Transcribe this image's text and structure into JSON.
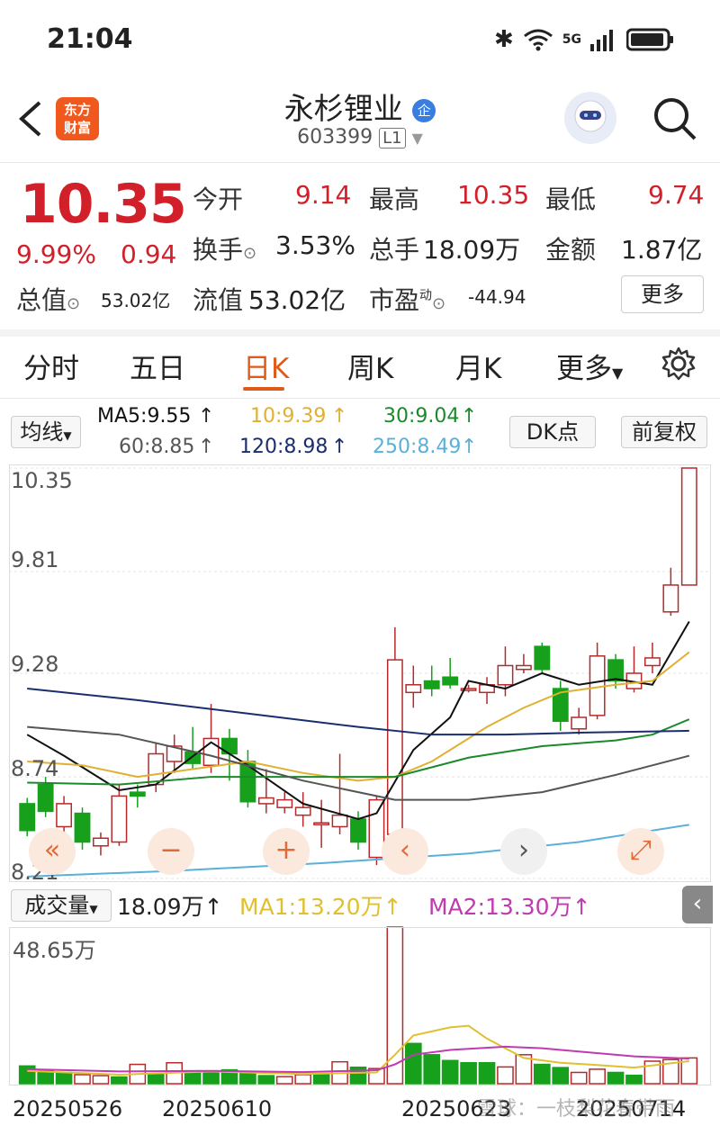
{
  "status": {
    "time": "21:04",
    "network": "5G"
  },
  "header": {
    "back_icon": "back-arrow-icon",
    "logo_line1": "东方",
    "logo_line2": "财富",
    "title": "永杉锂业",
    "badge": "企",
    "code": "603399",
    "code_suffix": "L1"
  },
  "quote": {
    "price": "10.35",
    "change_pct": "9.99%",
    "change": "0.94",
    "open_label": "今开",
    "open": "9.14",
    "high_label": "最高",
    "high": "10.35",
    "low_label": "最低",
    "low": "9.74",
    "turnover_label": "换手",
    "turnover": "3.53%",
    "volume_label": "总手",
    "volume": "18.09万",
    "amount_label": "金额",
    "amount": "1.87亿",
    "mcap_label": "总值",
    "mcap": "53.02亿",
    "float_label": "流值",
    "float": "53.02亿",
    "pe_label": "市盈",
    "pe_sup": "动",
    "pe": "-44.94",
    "more": "更多"
  },
  "tabs": [
    "分时",
    "五日",
    "日K",
    "周K",
    "月K",
    "更多"
  ],
  "active_tab": "日K",
  "ma": {
    "selector": "均线",
    "ma5": "MA5:9.55",
    "ma10": "10:9.39",
    "ma30": "30:9.04",
    "ma60": "60:8.85",
    "ma120": "120:8.98",
    "ma250": "250:8.49",
    "dk": "DK点",
    "adjust": "前复权"
  },
  "chart_data": {
    "type": "candlestick",
    "y_ticks": [
      "10.35",
      "9.81",
      "9.28",
      "8.74",
      "8.21"
    ],
    "ylim": [
      8.21,
      10.35
    ],
    "x_labels": [
      "20250526",
      "20250610",
      "20250623",
      "20250714"
    ],
    "candles": [
      {
        "o": 8.6,
        "c": 8.46,
        "h": 8.63,
        "l": 8.43
      },
      {
        "o": 8.7,
        "c": 8.56,
        "h": 8.74,
        "l": 8.53
      },
      {
        "o": 8.48,
        "c": 8.6,
        "h": 8.64,
        "l": 8.45
      },
      {
        "o": 8.55,
        "c": 8.4,
        "h": 8.58,
        "l": 8.36
      },
      {
        "o": 8.38,
        "c": 8.42,
        "h": 8.45,
        "l": 8.33
      },
      {
        "o": 8.4,
        "c": 8.64,
        "h": 8.7,
        "l": 8.38
      },
      {
        "o": 8.66,
        "c": 8.64,
        "h": 8.7,
        "l": 8.58
      },
      {
        "o": 8.7,
        "c": 8.86,
        "h": 8.92,
        "l": 8.66
      },
      {
        "o": 8.82,
        "c": 8.9,
        "h": 8.96,
        "l": 8.76
      },
      {
        "o": 8.87,
        "c": 8.81,
        "h": 9.0,
        "l": 8.78
      },
      {
        "o": 8.8,
        "c": 8.94,
        "h": 9.12,
        "l": 8.76
      },
      {
        "o": 8.94,
        "c": 8.86,
        "h": 8.99,
        "l": 8.72
      },
      {
        "o": 8.82,
        "c": 8.61,
        "h": 8.88,
        "l": 8.58
      },
      {
        "o": 8.6,
        "c": 8.63,
        "h": 8.78,
        "l": 8.55
      },
      {
        "o": 8.58,
        "c": 8.62,
        "h": 8.66,
        "l": 8.55
      },
      {
        "o": 8.54,
        "c": 8.58,
        "h": 8.66,
        "l": 8.48
      },
      {
        "o": 8.5,
        "c": 8.5,
        "h": 8.62,
        "l": 8.37
      },
      {
        "o": 8.48,
        "c": 8.54,
        "h": 8.86,
        "l": 8.44
      },
      {
        "o": 8.52,
        "c": 8.4,
        "h": 8.56,
        "l": 8.36
      },
      {
        "o": 8.32,
        "c": 8.62,
        "h": 8.64,
        "l": 8.28
      },
      {
        "o": 8.44,
        "c": 9.35,
        "h": 9.52,
        "l": 8.4
      },
      {
        "o": 9.18,
        "c": 9.22,
        "h": 9.32,
        "l": 9.1
      },
      {
        "o": 9.24,
        "c": 9.2,
        "h": 9.32,
        "l": 9.16
      },
      {
        "o": 9.26,
        "c": 9.22,
        "h": 9.36,
        "l": 9.2
      },
      {
        "o": 9.2,
        "c": 9.2,
        "h": 9.22,
        "l": 9.18
      },
      {
        "o": 9.18,
        "c": 9.22,
        "h": 9.26,
        "l": 9.12
      },
      {
        "o": 9.22,
        "c": 9.32,
        "h": 9.42,
        "l": 9.16
      },
      {
        "o": 9.3,
        "c": 9.32,
        "h": 9.38,
        "l": 9.28
      },
      {
        "o": 9.42,
        "c": 9.3,
        "h": 9.44,
        "l": 9.28
      },
      {
        "o": 9.2,
        "c": 9.03,
        "h": 9.24,
        "l": 8.98
      },
      {
        "o": 8.99,
        "c": 9.05,
        "h": 9.1,
        "l": 8.96
      },
      {
        "o": 9.06,
        "c": 9.37,
        "h": 9.44,
        "l": 9.04
      },
      {
        "o": 9.35,
        "c": 9.24,
        "h": 9.38,
        "l": 9.2
      },
      {
        "o": 9.2,
        "c": 9.28,
        "h": 9.42,
        "l": 9.18
      },
      {
        "o": 9.32,
        "c": 9.36,
        "h": 9.44,
        "l": 9.28
      },
      {
        "o": 9.6,
        "c": 9.74,
        "h": 9.83,
        "l": 9.58
      },
      {
        "o": 9.74,
        "c": 10.35,
        "h": 10.35,
        "l": 9.74
      }
    ],
    "ma_series": [
      {
        "name": "MA5",
        "color": "#111111",
        "points": [
          [
            0,
            8.96
          ],
          [
            2,
            8.85
          ],
          [
            5,
            8.67
          ],
          [
            7,
            8.7
          ],
          [
            10,
            8.92
          ],
          [
            12,
            8.8
          ],
          [
            15,
            8.6
          ],
          [
            18,
            8.52
          ],
          [
            19,
            8.55
          ],
          [
            21,
            8.88
          ],
          [
            23,
            9.05
          ],
          [
            24,
            9.24
          ],
          [
            26,
            9.2
          ],
          [
            28,
            9.28
          ],
          [
            30,
            9.22
          ],
          [
            32,
            9.25
          ],
          [
            34,
            9.22
          ],
          [
            36,
            9.55
          ]
        ]
      },
      {
        "name": "MA10",
        "color": "#e0b030",
        "points": [
          [
            0,
            8.82
          ],
          [
            3,
            8.8
          ],
          [
            6,
            8.74
          ],
          [
            9,
            8.78
          ],
          [
            12,
            8.82
          ],
          [
            15,
            8.76
          ],
          [
            18,
            8.72
          ],
          [
            20,
            8.74
          ],
          [
            22,
            8.82
          ],
          [
            25,
            9.0
          ],
          [
            27,
            9.1
          ],
          [
            29,
            9.18
          ],
          [
            32,
            9.22
          ],
          [
            34,
            9.24
          ],
          [
            36,
            9.39
          ]
        ]
      },
      {
        "name": "MA30",
        "color": "#1a8a2a",
        "points": [
          [
            0,
            8.71
          ],
          [
            5,
            8.7
          ],
          [
            10,
            8.74
          ],
          [
            15,
            8.74
          ],
          [
            20,
            8.74
          ],
          [
            24,
            8.84
          ],
          [
            28,
            8.9
          ],
          [
            32,
            8.93
          ],
          [
            34,
            8.96
          ],
          [
            36,
            9.04
          ]
        ]
      },
      {
        "name": "MA60",
        "color": "#555555",
        "points": [
          [
            0,
            9.0
          ],
          [
            5,
            8.96
          ],
          [
            10,
            8.85
          ],
          [
            15,
            8.72
          ],
          [
            20,
            8.62
          ],
          [
            24,
            8.62
          ],
          [
            28,
            8.66
          ],
          [
            32,
            8.75
          ],
          [
            36,
            8.85
          ]
        ]
      },
      {
        "name": "MA120",
        "color": "#1a2e6e",
        "points": [
          [
            0,
            9.2
          ],
          [
            6,
            9.14
          ],
          [
            12,
            9.07
          ],
          [
            18,
            9.0
          ],
          [
            22,
            8.96
          ],
          [
            26,
            8.96
          ],
          [
            30,
            8.97
          ],
          [
            36,
            8.98
          ]
        ]
      },
      {
        "name": "MA250",
        "color": "#5ab0d6",
        "points": [
          [
            0,
            8.22
          ],
          [
            8,
            8.25
          ],
          [
            16,
            8.29
          ],
          [
            24,
            8.34
          ],
          [
            30,
            8.4
          ],
          [
            36,
            8.49
          ]
        ]
      }
    ]
  },
  "volume": {
    "selector": "成交量",
    "total": "18.09万",
    "ma1": "MA1:13.20万",
    "ma2": "MA2:13.30万",
    "max_label": "48.65万",
    "values": [
      5.5,
      4.2,
      3.5,
      2.8,
      2.5,
      2.1,
      6.0,
      2.9,
      6.5,
      4.0,
      3.5,
      4.3,
      3.2,
      2.5,
      2.2,
      2.8,
      2.9,
      6.8,
      5.1,
      4.7,
      48.65,
      12.5,
      9.0,
      7.2,
      6.5,
      6.5,
      5.2,
      9.0,
      6.0,
      5.0,
      3.5,
      4.5,
      3.5,
      2.6,
      7.0,
      7.5,
      8.0
    ],
    "up": [
      false,
      false,
      false,
      true,
      true,
      false,
      true,
      false,
      true,
      false,
      false,
      false,
      false,
      false,
      true,
      true,
      false,
      true,
      false,
      true,
      true,
      false,
      false,
      false,
      false,
      false,
      true,
      true,
      false,
      false,
      true,
      true,
      false,
      false,
      true,
      true,
      true
    ]
  },
  "bottom": {
    "d1": "20250526",
    "d2": "20250610",
    "d3": "20250623",
    "d4": "20250714",
    "watermark": "雪球：一枝梨花春带雨"
  }
}
